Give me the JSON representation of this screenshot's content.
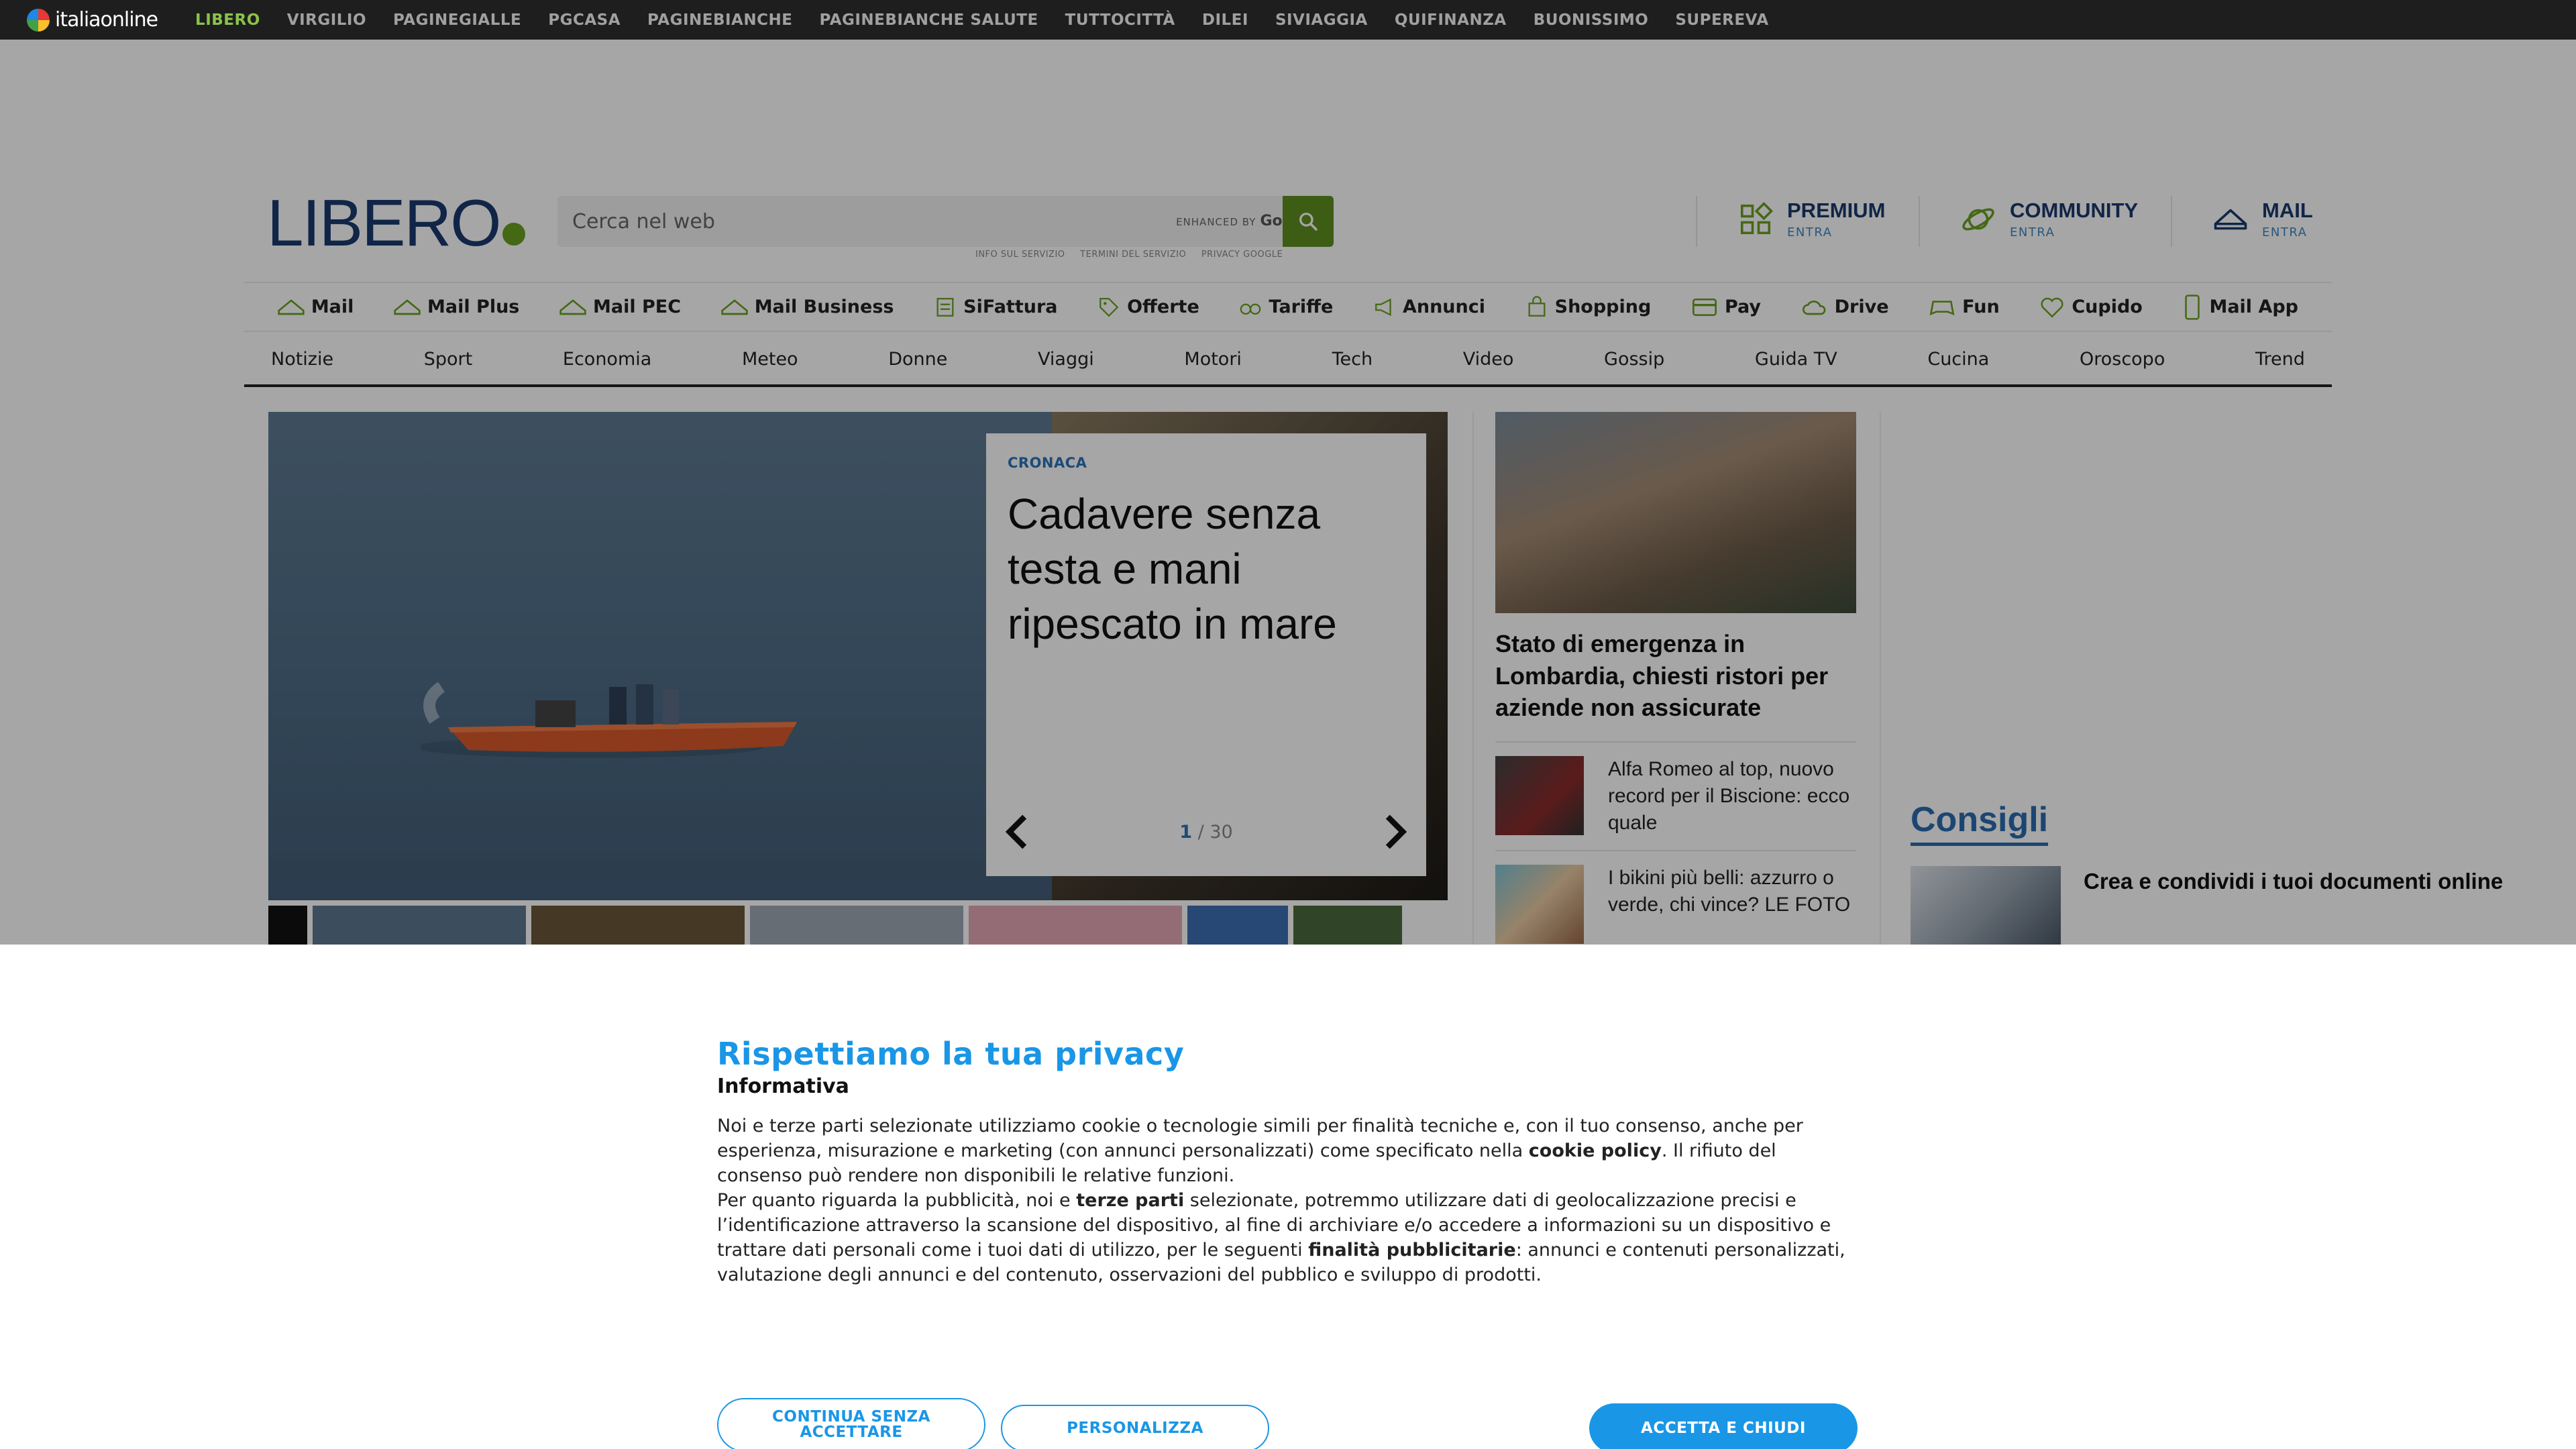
{
  "topbar": {
    "logo_text": "italiaonline",
    "links": [
      "LIBERO",
      "VIRGILIO",
      "PAGINEGIALLE",
      "PGCASA",
      "PAGINEBIANCHE",
      "PAGINEBIANCHE SALUTE",
      "TUTTOCITTÀ",
      "DILEI",
      "SIVIAGGIA",
      "QUIFINANZA",
      "BUONISSIMO",
      "SUPEREVA"
    ],
    "active_color": "#8bc34a"
  },
  "header": {
    "logo": "LIBERO",
    "search": {
      "placeholder": "Cerca nel web",
      "brand_prefix": "ENHANCED BY",
      "brand": "Google",
      "links": [
        "INFO SUL SERVIZIO",
        "TERMINI DEL SERVIZIO",
        "PRIVACY GOOGLE"
      ]
    },
    "services": [
      {
        "label": "PREMIUM",
        "sub": "ENTRA",
        "icon": "grid-icon"
      },
      {
        "label": "COMMUNITY",
        "sub": "ENTRA",
        "icon": "planet-icon"
      },
      {
        "label": "MAIL",
        "sub": "ENTRA",
        "icon": "mail-icon"
      }
    ]
  },
  "nav_services": [
    "Mail",
    "Mail Plus",
    "Mail PEC",
    "Mail Business",
    "SiFattura",
    "Offerte",
    "Tariffe",
    "Annunci",
    "Shopping",
    "Pay",
    "Drive",
    "Fun",
    "Cupido",
    "Mail App"
  ],
  "nav_sections": [
    "Notizie",
    "Sport",
    "Economia",
    "Meteo",
    "Donne",
    "Viaggi",
    "Motori",
    "Tech",
    "Video",
    "Gossip",
    "Guida TV",
    "Cucina",
    "Oroscopo",
    "Trend"
  ],
  "hero": {
    "category": "CRONACA",
    "title": "Cadavere senza testa e mani ripescato in mare",
    "page_current": "1",
    "page_total": "30",
    "page_sep": " / "
  },
  "side": {
    "lead_title": "Stato di emergenza in Lombardia, chiesti ristori per aziende non assicurate",
    "items": [
      "Alfa Romeo al top, nuovo record per il Biscione: ecco quale",
      "I bikini più belli: azzurro o verde, chi vince? LE FOTO"
    ]
  },
  "consigli": {
    "heading": "Consigli",
    "item": "Crea e condividi i tuoi documenti online"
  },
  "consent": {
    "title": "Rispettiamo la tua privacy",
    "subtitle": "Informativa",
    "p1_a": "Noi e terze parti selezionate utilizziamo cookie o tecnologie simili per finalità tecniche e, con il tuo consenso, anche per esperienza, misurazione e marketing (con annunci personalizzati) come specificato nella ",
    "p1_b": "cookie policy",
    "p1_c": ". Il rifiuto del consenso può rendere non disponibili le relative funzioni.",
    "p2_a": "Per quanto riguarda la pubblicità, noi e ",
    "p2_b": "terze parti",
    "p2_c": " selezionate, potremmo utilizzare dati di geolocalizzazione precisi e l’identificazione attraverso la scansione del dispositivo, al fine di archiviare e/o accedere a informazioni su un dispositivo e trattare dati personali come i tuoi dati di utilizzo, per le seguenti ",
    "p2_d": "finalità pubblicitarie",
    "p2_e": ": annunci e contenuti personalizzati, valutazione degli annunci e del contenuto, osservazioni del pubblico e sviluppo di prodotti.",
    "btn_continue": "CONTINUA SENZA ACCETTARE",
    "btn_customize": "PERSONALIZZA",
    "btn_accept": "ACCETTA E CHIUDI"
  }
}
